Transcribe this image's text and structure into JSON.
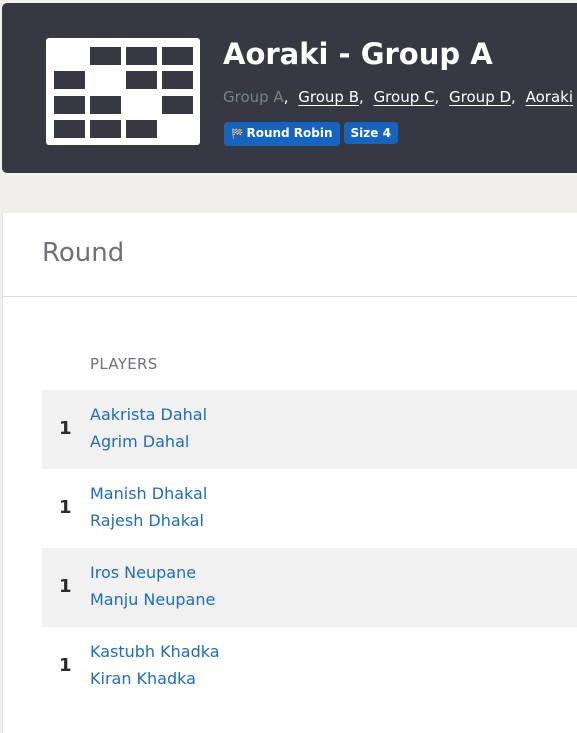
{
  "header": {
    "title": "Aoraki - Group A",
    "groups": {
      "current": "Group A",
      "links": [
        "Group B",
        "Group C",
        "Group D",
        "Aoraki"
      ]
    },
    "badges": {
      "format_label": "Round Robin",
      "size_label": "Size 4"
    },
    "logo_icon": "bracket-grid-icon"
  },
  "round": {
    "title": "Round",
    "players_header": "PLAYERS",
    "rows": [
      {
        "score": "1",
        "player1": "Aakrista Dahal",
        "player2": "Agrim Dahal"
      },
      {
        "score": "1",
        "player1": "Manish Dhakal",
        "player2": "Rajesh Dhakal"
      },
      {
        "score": "1",
        "player1": "Iros Neupane",
        "player2": "Manju Neupane"
      },
      {
        "score": "1",
        "player1": "Kastubh Khadka",
        "player2": "Kiran Khadka"
      }
    ]
  },
  "colors": {
    "header_bg": "#363941",
    "badge_bg": "#1565c0",
    "link": "#1e6bbf",
    "page_bg": "#f0efec"
  }
}
